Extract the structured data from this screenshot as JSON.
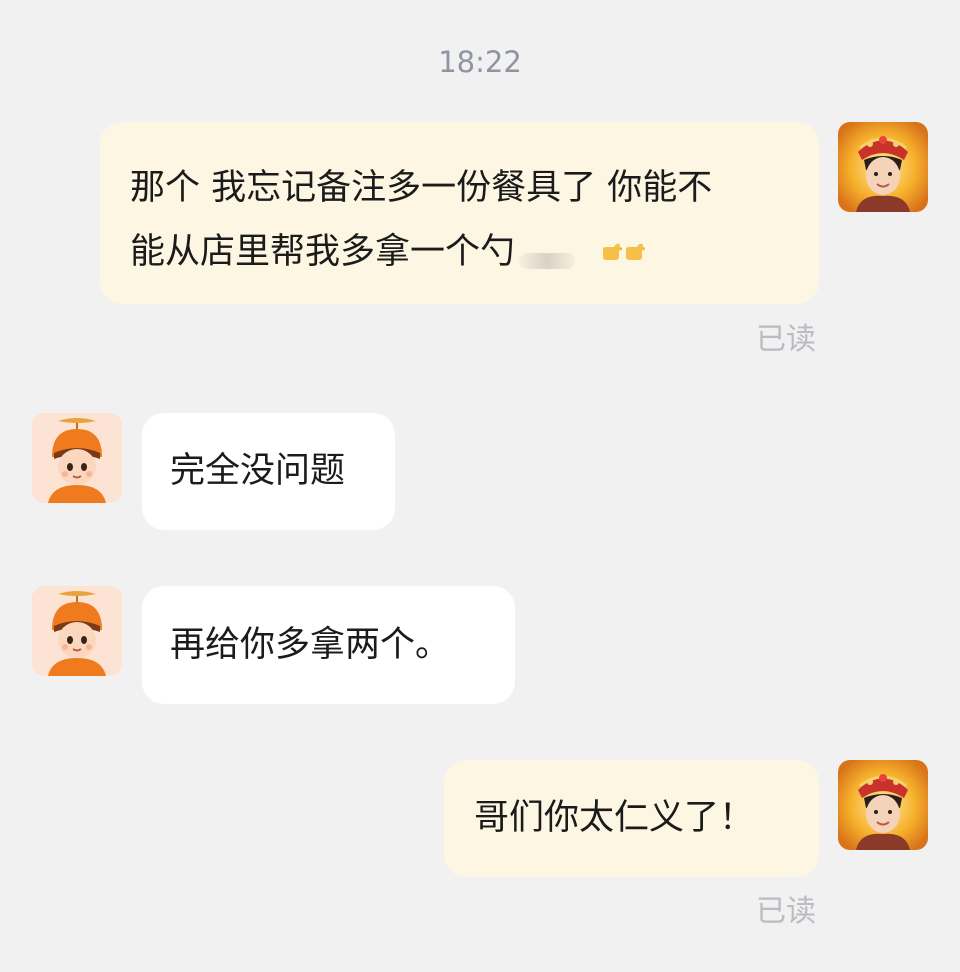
{
  "timestamp": "18:22",
  "messages": [
    {
      "sender": "self",
      "line1": "那个 我忘记备注多一份餐具了 你能不",
      "line2": "能从店里帮我多拿一个勺",
      "status": "已读"
    },
    {
      "sender": "rider",
      "text": "完全没问题"
    },
    {
      "sender": "rider",
      "text": "再给你多拿两个。"
    },
    {
      "sender": "self",
      "text": "哥们你太仁义了！",
      "status": "已读"
    }
  ],
  "icons": {
    "self_avatar": "child-deity-avatar-icon",
    "rider_avatar": "delivery-rider-avatar-icon",
    "emoji": "pointing-hand-emoji-icon"
  },
  "colors": {
    "background": "#f1f1f1",
    "self_bubble": "#fdf6e3",
    "other_bubble": "#ffffff",
    "status_text": "#b9bcc2",
    "timestamp_text": "#8e95a1"
  }
}
